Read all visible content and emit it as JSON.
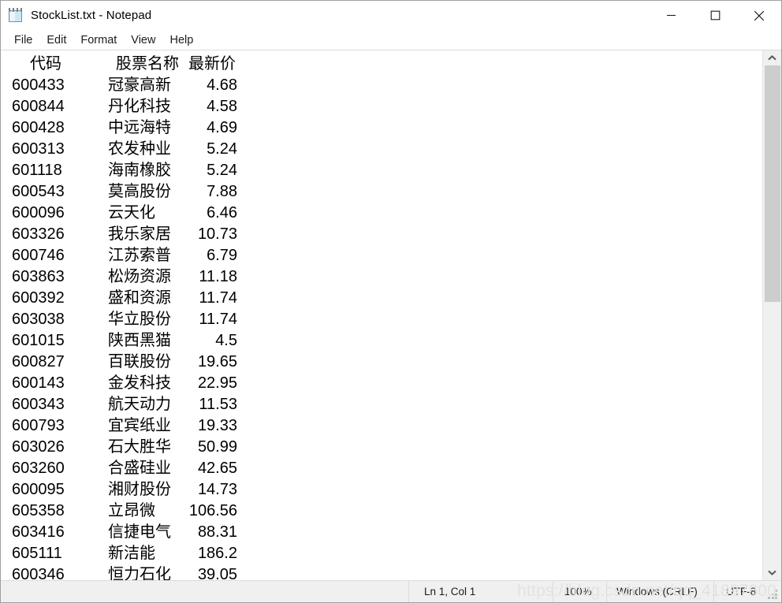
{
  "window": {
    "title": "StockList.txt - Notepad",
    "icon": "notepad-icon",
    "controls": {
      "minimize": "minimize-icon",
      "maximize": "maximize-icon",
      "close": "close-icon"
    }
  },
  "menubar": {
    "items": [
      {
        "label": "File"
      },
      {
        "label": "Edit"
      },
      {
        "label": "Format"
      },
      {
        "label": "View"
      },
      {
        "label": "Help"
      }
    ]
  },
  "document": {
    "header": {
      "code": "代码",
      "name": "股票名称",
      "price": "最新价"
    },
    "rows": [
      {
        "code": "600433",
        "name": "冠豪高新",
        "price": "4.68"
      },
      {
        "code": "600844",
        "name": "丹化科技",
        "price": "4.58"
      },
      {
        "code": "600428",
        "name": "中远海特",
        "price": "4.69"
      },
      {
        "code": "600313",
        "name": "农发种业",
        "price": "5.24"
      },
      {
        "code": "601118",
        "name": "海南橡胶",
        "price": "5.24"
      },
      {
        "code": "600543",
        "name": "莫高股份",
        "price": "7.88"
      },
      {
        "code": "600096",
        "name": "云天化",
        "price": "6.46"
      },
      {
        "code": "603326",
        "name": "我乐家居",
        "price": "10.73"
      },
      {
        "code": "600746",
        "name": "江苏索普",
        "price": "6.79"
      },
      {
        "code": "603863",
        "name": "松炀资源",
        "price": "11.18"
      },
      {
        "code": "600392",
        "name": "盛和资源",
        "price": "11.74"
      },
      {
        "code": "603038",
        "name": "华立股份",
        "price": "11.74"
      },
      {
        "code": "601015",
        "name": "陕西黑猫",
        "price": "4.5"
      },
      {
        "code": "600827",
        "name": "百联股份",
        "price": "19.65"
      },
      {
        "code": "600143",
        "name": "金发科技",
        "price": "22.95"
      },
      {
        "code": "600343",
        "name": "航天动力",
        "price": "11.53"
      },
      {
        "code": "600793",
        "name": "宜宾纸业",
        "price": "19.33"
      },
      {
        "code": "603026",
        "name": "石大胜华",
        "price": "50.99"
      },
      {
        "code": "603260",
        "name": "合盛硅业",
        "price": "42.65"
      },
      {
        "code": "600095",
        "name": "湘财股份",
        "price": "14.73"
      },
      {
        "code": "605358",
        "name": "立昂微",
        "price": "106.56"
      },
      {
        "code": "603416",
        "name": "信捷电气",
        "price": "88.31"
      },
      {
        "code": "605111",
        "name": "新洁能",
        "price": "186.2"
      },
      {
        "code": "600346",
        "name": "恒力石化",
        "price": "39.05"
      }
    ]
  },
  "scrollbar": {
    "up_arrow": "chevron-up-icon",
    "down_arrow": "chevron-down-icon"
  },
  "statusbar": {
    "cursor": "Ln 1, Col 1",
    "zoom": "100%",
    "line_ending": "Windows (CRLF)",
    "encoding": "UTF-8"
  },
  "watermark": "https://blog.csdn.net/qq_41897800"
}
